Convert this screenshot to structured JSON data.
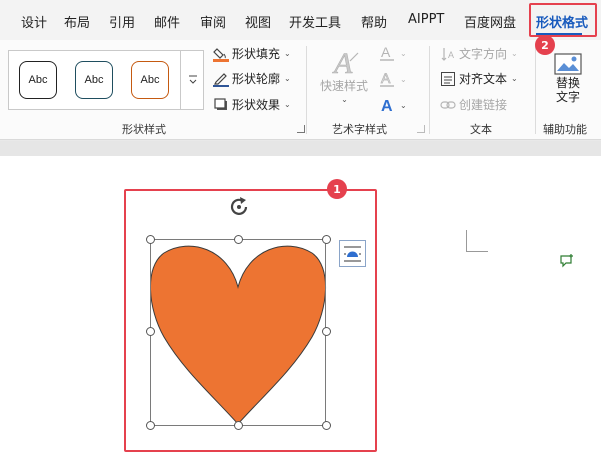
{
  "tabs": [
    {
      "label": "设计",
      "active": false
    },
    {
      "label": "布局",
      "active": false
    },
    {
      "label": "引用",
      "active": false
    },
    {
      "label": "邮件",
      "active": false
    },
    {
      "label": "审阅",
      "active": false
    },
    {
      "label": "视图",
      "active": false
    },
    {
      "label": "开发工具",
      "active": false
    },
    {
      "label": "帮助",
      "active": false
    },
    {
      "label": "AIPPT",
      "active": false
    },
    {
      "label": "百度网盘",
      "active": false
    },
    {
      "label": "形状格式",
      "active": true
    }
  ],
  "ribbon": {
    "shape_styles": {
      "label": "形状样式",
      "swatches": [
        {
          "text": "Abc",
          "border_color": "#222222"
        },
        {
          "text": "Abc",
          "border_color": "#1f4e5f"
        },
        {
          "text": "Abc",
          "border_color": "#c55a11"
        }
      ],
      "fill_label": "形状填充",
      "outline_label": "形状轮廓",
      "effects_label": "形状效果"
    },
    "wordart": {
      "label": "艺术字样式",
      "quick_styles_label": "快速样式"
    },
    "text_group": {
      "label": "文本",
      "direction_label": "文字方向",
      "align_label": "对齐文本",
      "link_label": "创建链接"
    },
    "accessibility": {
      "label": "辅助功能",
      "alt_text_line1": "替换",
      "alt_text_line2": "文字"
    }
  },
  "annotations": {
    "badge_1": "1",
    "badge_2": "2",
    "highlight_color": "#e5414e"
  },
  "colors": {
    "accent": "#185abd",
    "heart_fill": "#ed7432",
    "heart_stroke": "#3a3a3a"
  },
  "shape": {
    "type": "heart",
    "selected": true
  }
}
